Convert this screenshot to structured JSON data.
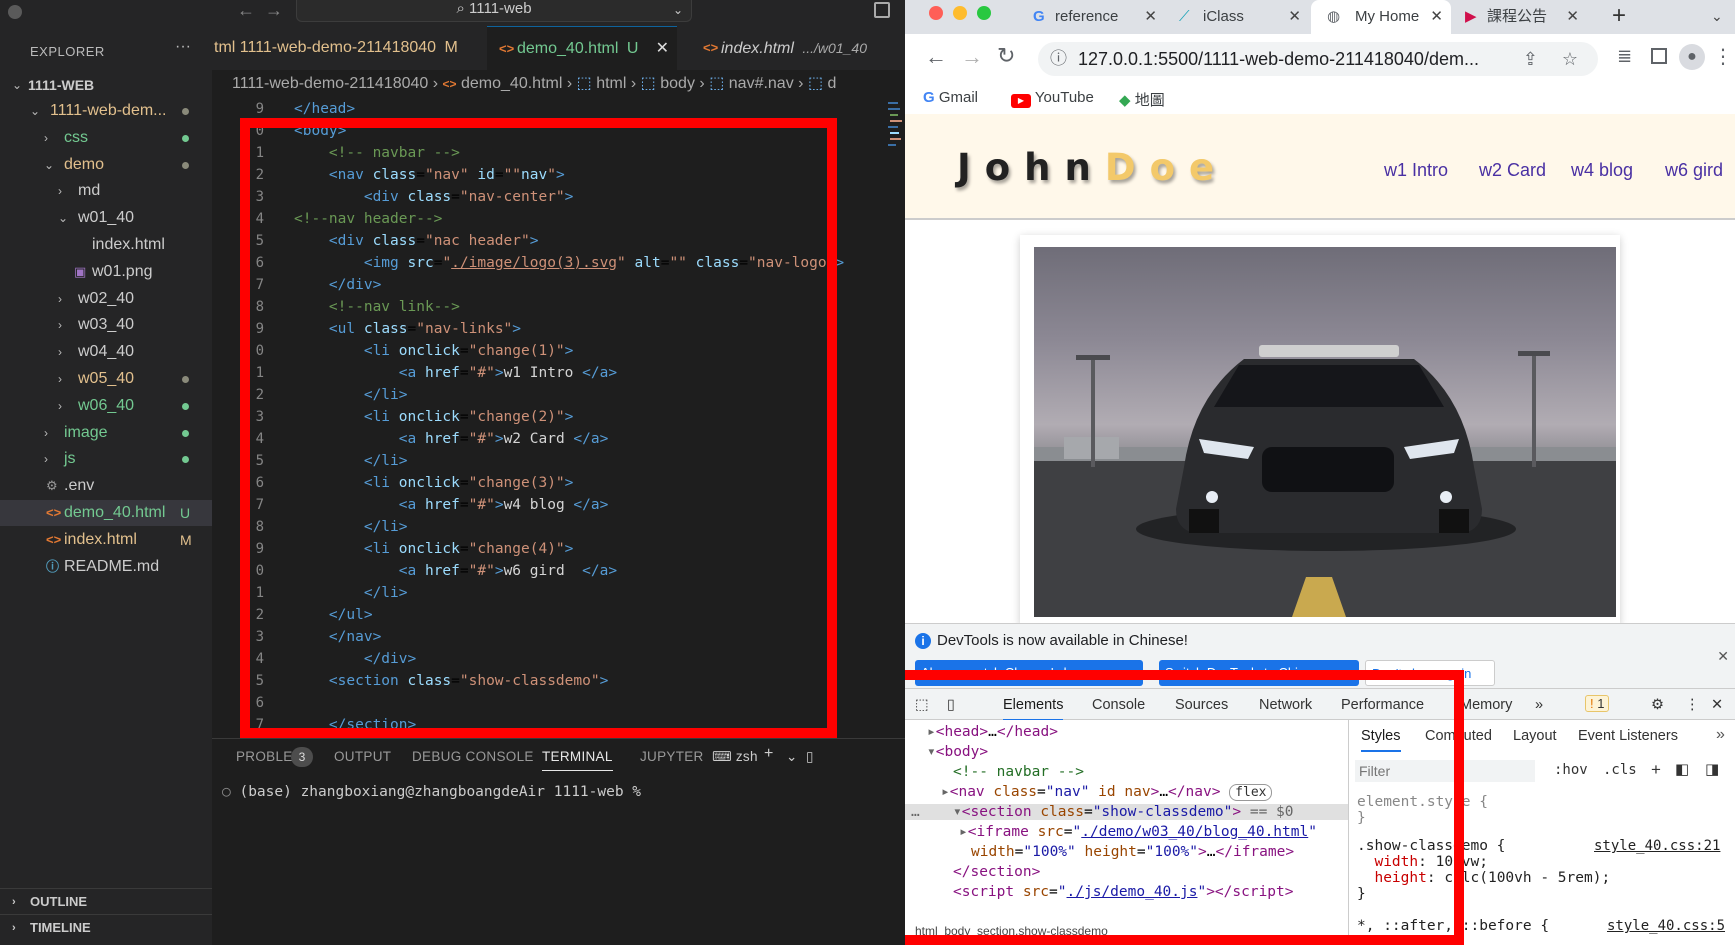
{
  "vscode": {
    "search": "1111-web",
    "explorer": {
      "header": "EXPLORER",
      "root": "1111-WEB",
      "items": [
        {
          "label": "1111-web-dem...",
          "depth": 1,
          "type": "folder-open",
          "status": "dot-gray"
        },
        {
          "label": "css",
          "depth": 2,
          "type": "folder",
          "status": "dot-green"
        },
        {
          "label": "demo",
          "depth": 2,
          "type": "folder-open",
          "status": "dot-gray"
        },
        {
          "label": "md",
          "depth": 3,
          "type": "folder",
          "status": ""
        },
        {
          "label": "w01_40",
          "depth": 3,
          "type": "folder-open",
          "status": ""
        },
        {
          "label": "index.html",
          "depth": 4,
          "type": "file",
          "status": ""
        },
        {
          "label": "w01.png",
          "depth": 4,
          "type": "image",
          "status": ""
        },
        {
          "label": "w02_40",
          "depth": 3,
          "type": "folder",
          "status": ""
        },
        {
          "label": "w03_40",
          "depth": 3,
          "type": "folder",
          "status": ""
        },
        {
          "label": "w04_40",
          "depth": 3,
          "type": "folder",
          "status": ""
        },
        {
          "label": "w05_40",
          "depth": 3,
          "type": "folder",
          "status": "dot-gray"
        },
        {
          "label": "w06_40",
          "depth": 3,
          "type": "folder",
          "status": "dot-green"
        },
        {
          "label": "image",
          "depth": 2,
          "type": "folder",
          "status": "dot-green"
        },
        {
          "label": "js",
          "depth": 2,
          "type": "folder",
          "status": "dot-green"
        },
        {
          "label": ".env",
          "depth": 2,
          "type": "gear",
          "status": ""
        },
        {
          "label": "demo_40.html",
          "depth": 2,
          "type": "html",
          "status": "U"
        },
        {
          "label": "index.html",
          "depth": 2,
          "type": "html",
          "status": "M"
        },
        {
          "label": "README.md",
          "depth": 2,
          "type": "info",
          "status": ""
        }
      ],
      "outline": "OUTLINE",
      "timeline": "TIMELINE"
    },
    "tabs": [
      {
        "label": "tml 1111-web-demo-211418040",
        "status": "M"
      },
      {
        "label": "demo_40.html",
        "status": "U"
      },
      {
        "label": "index.html",
        "hint": ".../w01_40"
      }
    ],
    "breadcrumb": [
      "1111-web-demo-211418040",
      "demo_40.html",
      "html",
      "body",
      "nav#.nav",
      "d"
    ],
    "code_lines": [
      {
        "n": "9",
        "html": "<span class='tag'>&lt;/head&gt;</span>"
      },
      {
        "n": "0",
        "html": "<span class='tag'>&lt;body&gt;</span>"
      },
      {
        "n": "1",
        "html": "    <span class='cmt'>&lt;!-- navbar --&gt;</span>"
      },
      {
        "n": "2",
        "html": "    <span class='tag'>&lt;nav</span> <span class='attr'>class</span>=<span class='str'>\"nav\"</span> <span class='attr'>id</span>=<span class='str'>\"\"</span><span class='attr'>nav</span><span class='str'>\"</span><span class='tag'>&gt;</span>"
      },
      {
        "n": "3",
        "html": "        <span class='tag'>&lt;div</span> <span class='attr'>class</span>=<span class='str'>\"nav-center\"</span><span class='tag'>&gt;</span>"
      },
      {
        "n": "4",
        "html": "<span class='cmt'>&lt;!--nav header--&gt;</span>"
      },
      {
        "n": "5",
        "html": "    <span class='tag'>&lt;div</span> <span class='attr'>class</span>=<span class='str'>\"nac header\"</span><span class='tag'>&gt;</span>"
      },
      {
        "n": "6",
        "html": "        <span class='tag'>&lt;img</span> <span class='attr'>src</span>=<span class='str'>\"<span class='ul'>./image/logo(3).svg</span>\"</span> <span class='attr'>alt</span>=<span class='str'>\"\"</span> <span class='attr'>class</span>=<span class='str'>\"nav-logo\"</span><span class='tag'>&gt;</span>"
      },
      {
        "n": "7",
        "html": "    <span class='tag'>&lt;/div&gt;</span>"
      },
      {
        "n": "8",
        "html": "    <span class='cmt'>&lt;!--nav link--&gt;</span>"
      },
      {
        "n": "9",
        "html": "    <span class='tag'>&lt;ul</span> <span class='attr'>class</span>=<span class='str'>\"nav-links\"</span><span class='tag'>&gt;</span>"
      },
      {
        "n": "0",
        "html": "        <span class='tag'>&lt;li</span> <span class='attr'>onclick</span>=<span class='str'>\"change(1)\"</span><span class='tag'>&gt;</span>"
      },
      {
        "n": "1",
        "html": "            <span class='tag'>&lt;a</span> <span class='attr'>href</span>=<span class='str'>\"#\"</span><span class='tag'>&gt;</span><span class='txt'>w1 Intro </span><span class='tag'>&lt;/a&gt;</span>"
      },
      {
        "n": "2",
        "html": "        <span class='tag'>&lt;/li&gt;</span>"
      },
      {
        "n": "3",
        "html": "        <span class='tag'>&lt;li</span> <span class='attr'>onclick</span>=<span class='str'>\"change(2)\"</span><span class='tag'>&gt;</span>"
      },
      {
        "n": "4",
        "html": "            <span class='tag'>&lt;a</span> <span class='attr'>href</span>=<span class='str'>\"#\"</span><span class='tag'>&gt;</span><span class='txt'>w2 Card </span><span class='tag'>&lt;/a&gt;</span>"
      },
      {
        "n": "5",
        "html": "        <span class='tag'>&lt;/li&gt;</span>"
      },
      {
        "n": "6",
        "html": "        <span class='tag'>&lt;li</span> <span class='attr'>onclick</span>=<span class='str'>\"change(3)\"</span><span class='tag'>&gt;</span>"
      },
      {
        "n": "7",
        "html": "            <span class='tag'>&lt;a</span> <span class='attr'>href</span>=<span class='str'>\"#\"</span><span class='tag'>&gt;</span><span class='txt'>w4 blog </span><span class='tag'>&lt;/a&gt;</span>"
      },
      {
        "n": "8",
        "html": "        <span class='tag'>&lt;/li&gt;</span>"
      },
      {
        "n": "9",
        "html": "        <span class='tag'>&lt;li</span> <span class='attr'>onclick</span>=<span class='str'>\"change(4)\"</span><span class='tag'>&gt;</span>"
      },
      {
        "n": "0",
        "html": "            <span class='tag'>&lt;a</span> <span class='attr'>href</span>=<span class='str'>\"#\"</span><span class='tag'>&gt;</span><span class='txt'>w6 gird  </span><span class='tag'>&lt;/a&gt;</span>"
      },
      {
        "n": "1",
        "html": "        <span class='tag'>&lt;/li&gt;</span>"
      },
      {
        "n": "2",
        "html": "    <span class='tag'>&lt;/ul&gt;</span>"
      },
      {
        "n": "3",
        "html": "    <span class='tag'>&lt;/nav&gt;</span>"
      },
      {
        "n": "4",
        "html": "        <span class='tag'>&lt;/div&gt;</span>"
      },
      {
        "n": "5",
        "html": "    <span class='tag'>&lt;section</span> <span class='attr'>class</span>=<span class='str'>\"show-classdemo\"</span><span class='tag'>&gt;</span>"
      },
      {
        "n": "6",
        "html": ""
      },
      {
        "n": "7",
        "html": "    <span class='tag'>&lt;/section&gt;</span>"
      }
    ],
    "panel": {
      "tabs": [
        "PROBLEMS",
        "OUTPUT",
        "DEBUG CONSOLE",
        "TERMINAL",
        "JUPYTER"
      ],
      "problems_count": "3",
      "shell": "zsh",
      "terminal_line": "(base) zhangboxiang@zhangboangdeAir 1111-web %"
    }
  },
  "chrome": {
    "tabs": [
      {
        "label": "reference"
      },
      {
        "label": "iClass"
      },
      {
        "label": "My Home"
      },
      {
        "label": "課程公告"
      }
    ],
    "url": "127.0.0.1:5500/1111-web-demo-211418040/dem...",
    "bookmarks": [
      "Gmail",
      "YouTube",
      "地圖"
    ],
    "site": {
      "brand_main": "John",
      "brand_hl": "Doe",
      "nav_links": [
        "w1 Intro",
        "w2 Card",
        "w4 blog",
        "w6 gird"
      ]
    },
    "devtools": {
      "info": "DevTools is now available in Chinese!",
      "buttons": [
        "Always match Chrome's language",
        "Switch DevTools to Chinese",
        "Don't show again"
      ],
      "tabs": [
        "Elements",
        "Console",
        "Sources",
        "Network",
        "Performance",
        "Memory"
      ],
      "warnings": "1",
      "style_tabs": [
        "Styles",
        "Computed",
        "Layout",
        "Event Listeners"
      ],
      "filter_placeholder": "Filter",
      "filter_tools": [
        ":hov",
        ".cls"
      ],
      "flex_badge": "flex",
      "selected_suffix": "== $0",
      "status_path": "html  body  section.show-classdemo"
    }
  }
}
